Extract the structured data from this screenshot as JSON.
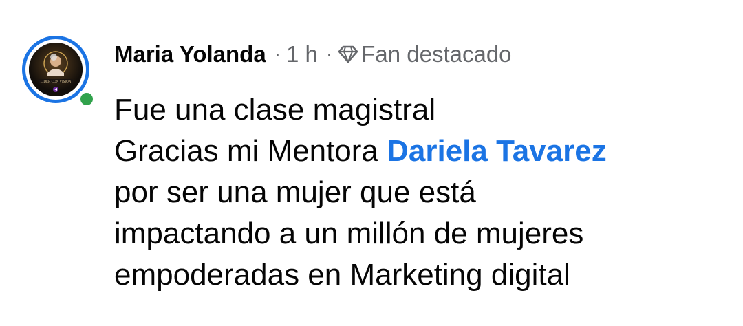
{
  "comment": {
    "author": "Maria Yolanda",
    "dot": "·",
    "time": "1 h",
    "badge_icon": "diamond-icon",
    "badge_label": "Fan destacado",
    "avatar_caption": "LIDER CON VISION",
    "lines": [
      {
        "text": "Fue una clase magistral"
      },
      {
        "text": "Gracias mi Mentora ",
        "mention": "Dariela Tavarez"
      },
      {
        "text": "por ser una mujer que está"
      },
      {
        "text": "impactando a un millón de mujeres"
      },
      {
        "text": "empoderadas en Marketing digital"
      }
    ],
    "colors": {
      "mention": "#1b74e4",
      "ring": "#1b74e4",
      "online": "#31a24c",
      "meta": "#65676b"
    }
  }
}
